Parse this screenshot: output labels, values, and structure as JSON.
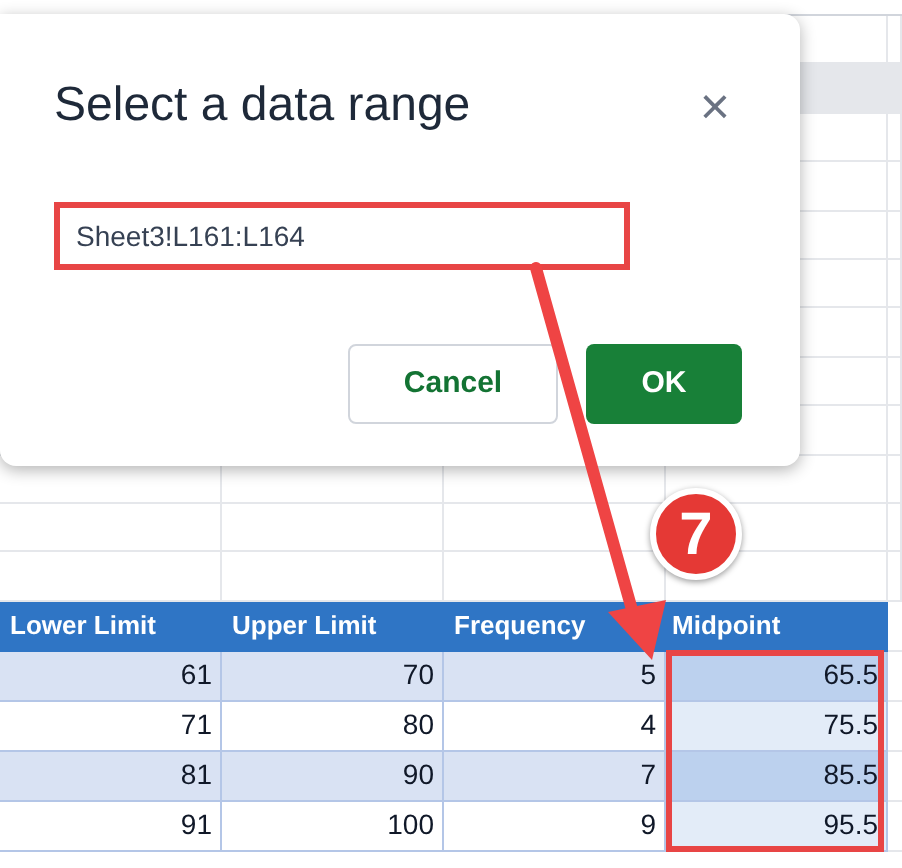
{
  "dialog": {
    "title": "Select a data range",
    "close": "×",
    "range_field": {
      "value": "Sheet3!L161:L164"
    },
    "buttons": [
      {
        "label": "Cancel",
        "kind": "secondary"
      },
      {
        "label": "OK",
        "kind": "primary"
      }
    ]
  },
  "table": {
    "columns": [
      {
        "label": "Lower Limit",
        "selected": false
      },
      {
        "label": "Upper Limit",
        "selected": false
      },
      {
        "label": "Frequency",
        "selected": false
      },
      {
        "label": "Midpoint",
        "selected": true
      }
    ],
    "rows": [
      {
        "cells": [
          "61",
          "70",
          "5",
          "65.5"
        ],
        "banded": true
      },
      {
        "cells": [
          "71",
          "80",
          "4",
          "75.5"
        ],
        "banded": false
      },
      {
        "cells": [
          "81",
          "90",
          "7",
          "85.5"
        ],
        "banded": true
      },
      {
        "cells": [
          "91",
          "100",
          "9",
          "95.5"
        ],
        "banded": false
      }
    ]
  },
  "annotation": {
    "step": "7"
  }
}
